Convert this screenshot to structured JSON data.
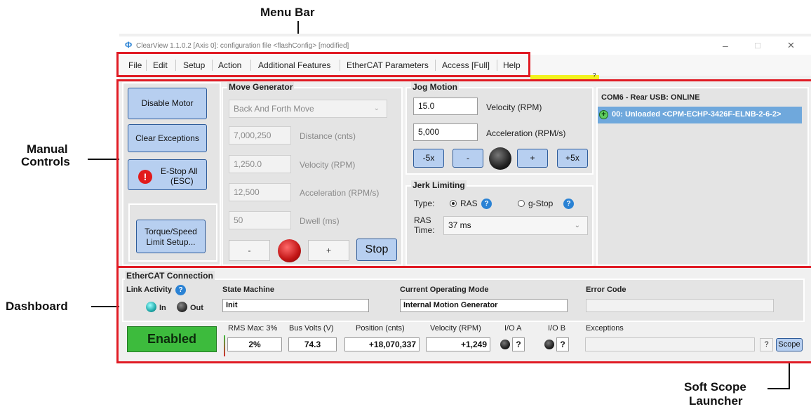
{
  "annotations": {
    "menu_bar": "Menu Bar",
    "manual_controls_line1": "Manual",
    "manual_controls_line2": "Controls",
    "dashboard": "Dashboard",
    "soft_scope_line1": "Soft Scope",
    "soft_scope_line2": "Launcher"
  },
  "window": {
    "title": "ClearView 1.1.0.2 [Axis 0]: configuration file <flashConfig> [modified]",
    "min_glyph": "–",
    "max_glyph": "□",
    "close_glyph": "✕",
    "warning_marker": "?"
  },
  "menu": [
    "File",
    "Edit",
    "Setup",
    "Action",
    "Additional Features",
    "EtherCAT Parameters",
    "Access [Full]",
    "Help"
  ],
  "left_buttons": {
    "disable_motor": "Disable Motor",
    "clear_exceptions": "Clear Exceptions",
    "estop_line1": "E-Stop All",
    "estop_line2": "(ESC)",
    "estop_icon": "!",
    "torque_line1": "Torque/Speed",
    "torque_line2": "Limit Setup..."
  },
  "move_generator": {
    "title": "Move Generator",
    "mode": "Back And Forth Move",
    "dropdown_glyph": "⌄",
    "distance_value": "7,000,250",
    "distance_label": "Distance (cnts)",
    "velocity_value": "1,250.0",
    "velocity_label": "Velocity (RPM)",
    "accel_value": "12,500",
    "accel_label": "Acceleration (RPM/s)",
    "dwell_value": "50",
    "dwell_label": "Dwell (ms)",
    "minus": "-",
    "plus": "+",
    "stop": "Stop"
  },
  "jog_motion": {
    "title": "Jog Motion",
    "velocity_value": "15.0",
    "velocity_label": "Velocity (RPM)",
    "accel_value": "5,000",
    "accel_label": "Acceleration (RPM/s)",
    "buttons": [
      "-5x",
      "-",
      "+",
      "+5x"
    ]
  },
  "jerk_limiting": {
    "title": "Jerk Limiting",
    "type_label": "Type:",
    "option_ras": "RAS",
    "option_gstop": "g-Stop",
    "help": "?",
    "ras_time_line1": "RAS",
    "ras_time_line2": "Time:",
    "ras_time_value": "37 ms",
    "dropdown_glyph": "⌄"
  },
  "node_list": {
    "port": "COM6 - Rear USB: ONLINE",
    "node": "00: Unloaded <CPM-ECHP-3426F-ELNB-2-6-2>",
    "node_icon": "+"
  },
  "ethercat": {
    "title": "EtherCAT Connection",
    "link_activity": "Link Activity",
    "help": "?",
    "in": "In",
    "out": "Out",
    "state_machine_label": "State Machine",
    "state_machine_value": "Init",
    "mode_label": "Current Operating Mode",
    "mode_value": "Internal Motion Generator",
    "error_label": "Error Code",
    "error_value": ""
  },
  "status_bar": {
    "enabled": "Enabled",
    "rms_label": "RMS Max: 3%",
    "rms_value": "2%",
    "bus_label": "Bus Volts (V)",
    "bus_value": "74.3",
    "position_label": "Position (cnts)",
    "position_value": "+18,070,337",
    "velocity_label": "Velocity (RPM)",
    "velocity_value": "+1,249",
    "ioa_label": "I/O A",
    "iob_label": "I/O B",
    "io_value": "?",
    "exceptions_label": "Exceptions",
    "exceptions_value": "",
    "help": "?",
    "scope": "Scope"
  },
  "colors": {
    "highlight_red": "#e01b24",
    "enabled_green": "#3dbb3d",
    "button_blue": "#b7cff0",
    "selection_blue": "#6fa8dc",
    "help_blue": "#2a82d4"
  }
}
